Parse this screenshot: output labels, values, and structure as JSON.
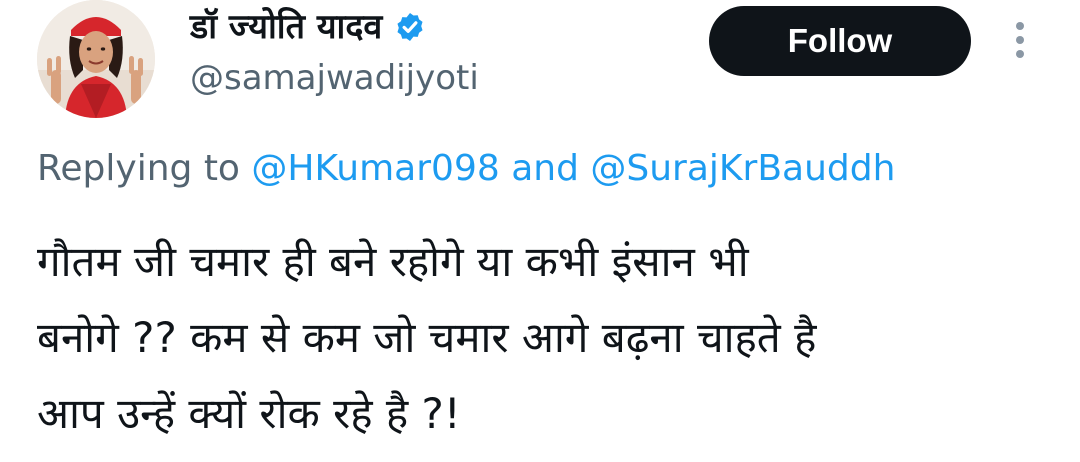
{
  "author": {
    "display_name": "डॉ ज्योति यादव",
    "handle": "@samajwadijyoti",
    "verified": true,
    "avatar_icon": "profile-photo"
  },
  "actions": {
    "follow_label": "Follow",
    "more_icon": "vertical-ellipsis-icon"
  },
  "reply": {
    "prefix": "Replying to ",
    "mentions": [
      "@HKumar098",
      "@SurajKrBauddh"
    ],
    "joiner": " and "
  },
  "tweet": {
    "lines": [
      "गौतम जी  चमार ही बने रहोगे या कभी इंसान भी",
      "बनोगे ?? कम से कम जो चमार आगे बढ़ना चाहते है",
      "आप उन्हें क्यों रोक रहे है ?!"
    ]
  },
  "colors": {
    "accent": "#1d9bf0",
    "secondary_text": "#536471",
    "primary_text": "#0f1419",
    "follow_bg": "#0f1419"
  }
}
